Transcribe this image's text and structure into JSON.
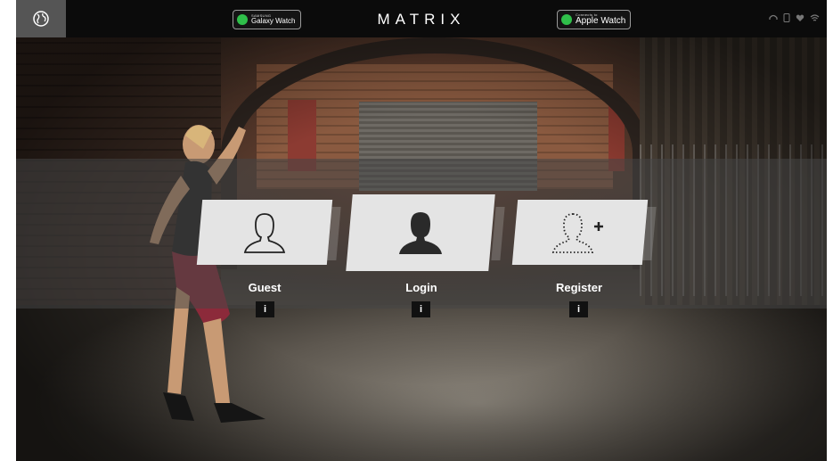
{
  "header": {
    "brand": "MATRIX",
    "globe_icon": "globe-icon",
    "samsung_badge": {
      "small_text": "SAMSUNG",
      "label": "Galaxy Watch"
    },
    "apple_badge": {
      "small_text": "Connects to",
      "label": "Apple Watch"
    },
    "status_icons": [
      "headphones-icon",
      "phone-icon",
      "heart-icon",
      "wifi-icon"
    ]
  },
  "options": [
    {
      "label": "Guest",
      "info": "i",
      "icon": "user-outline-icon"
    },
    {
      "label": "Login",
      "info": "i",
      "icon": "user-filled-icon"
    },
    {
      "label": "Register",
      "info": "i",
      "icon": "add-user-icon"
    }
  ],
  "colors": {
    "topbar": "#0b0b0b",
    "card": "#e4e4e4",
    "band": "#464646",
    "accent_green": "#2fbf4a"
  }
}
